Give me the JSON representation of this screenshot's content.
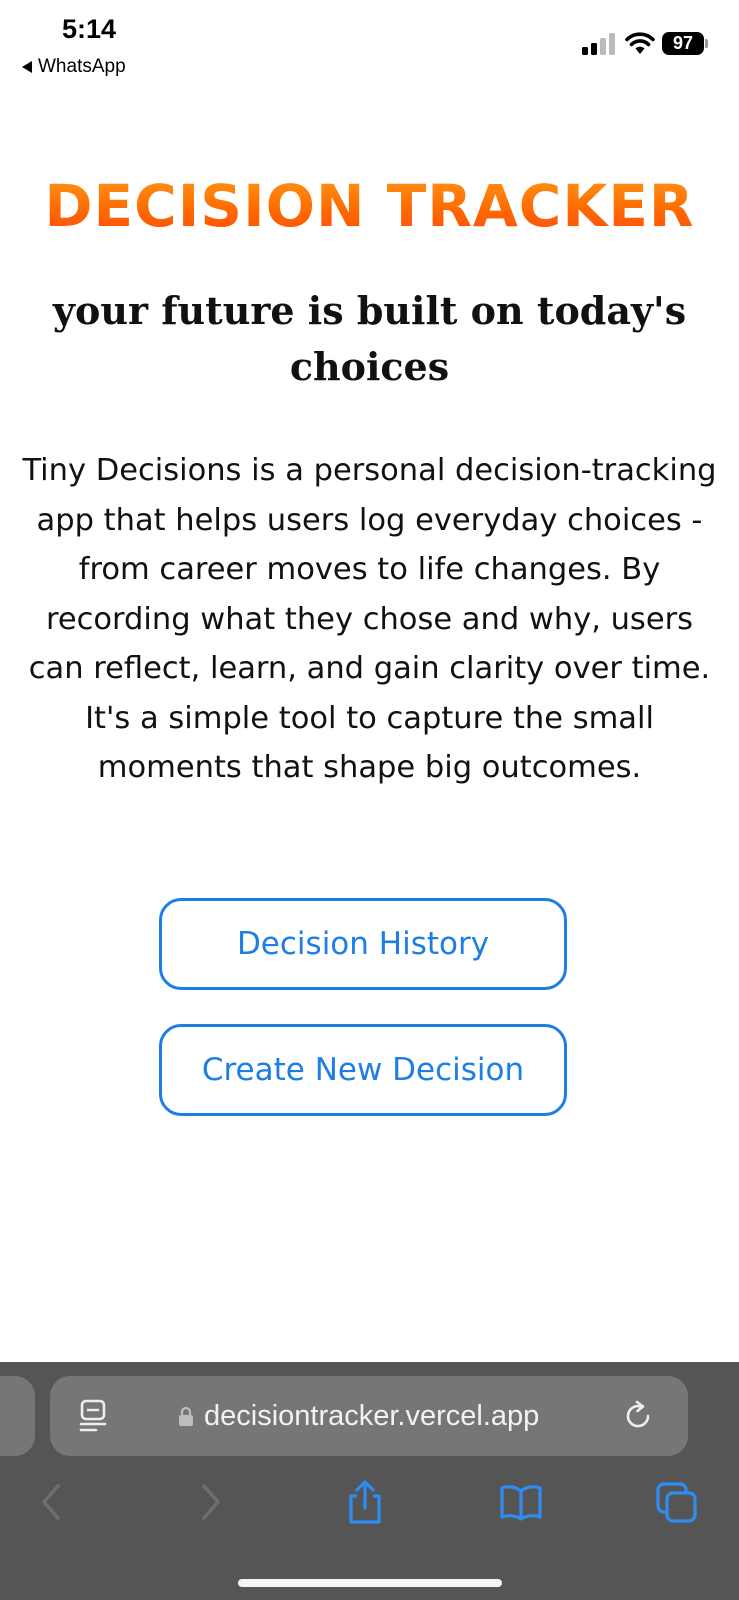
{
  "status_bar": {
    "time": "5:14",
    "back_app": "WhatsApp",
    "battery": "97",
    "icons": [
      "signal-icon",
      "wifi-icon",
      "battery-icon"
    ]
  },
  "page": {
    "title": "DECISION TRACKER",
    "subtitle": "your future is built on today's choices",
    "description": "Tiny Decisions is a personal decision-tracking app that helps users log everyday choices - from career moves to life changes. By recording what they chose and why, users can reflect, learn, and gain clarity over time. It's a simple tool to capture the small moments that shape big outcomes.",
    "buttons": {
      "history": "Decision History",
      "create": "Create New Decision"
    }
  },
  "browser": {
    "url": "decisiontracker.vercel.app",
    "icons": [
      "reader-icon",
      "lock-icon",
      "reload-icon",
      "back-icon",
      "forward-icon",
      "share-icon",
      "bookmarks-icon",
      "tabs-icon"
    ]
  },
  "colors": {
    "title_gradient_top": "#ff9a1a",
    "title_gradient_bottom": "#ff4a0e",
    "button_accent": "#1e7ee6",
    "browser_bar": "#555555",
    "url_pill": "#767676"
  }
}
